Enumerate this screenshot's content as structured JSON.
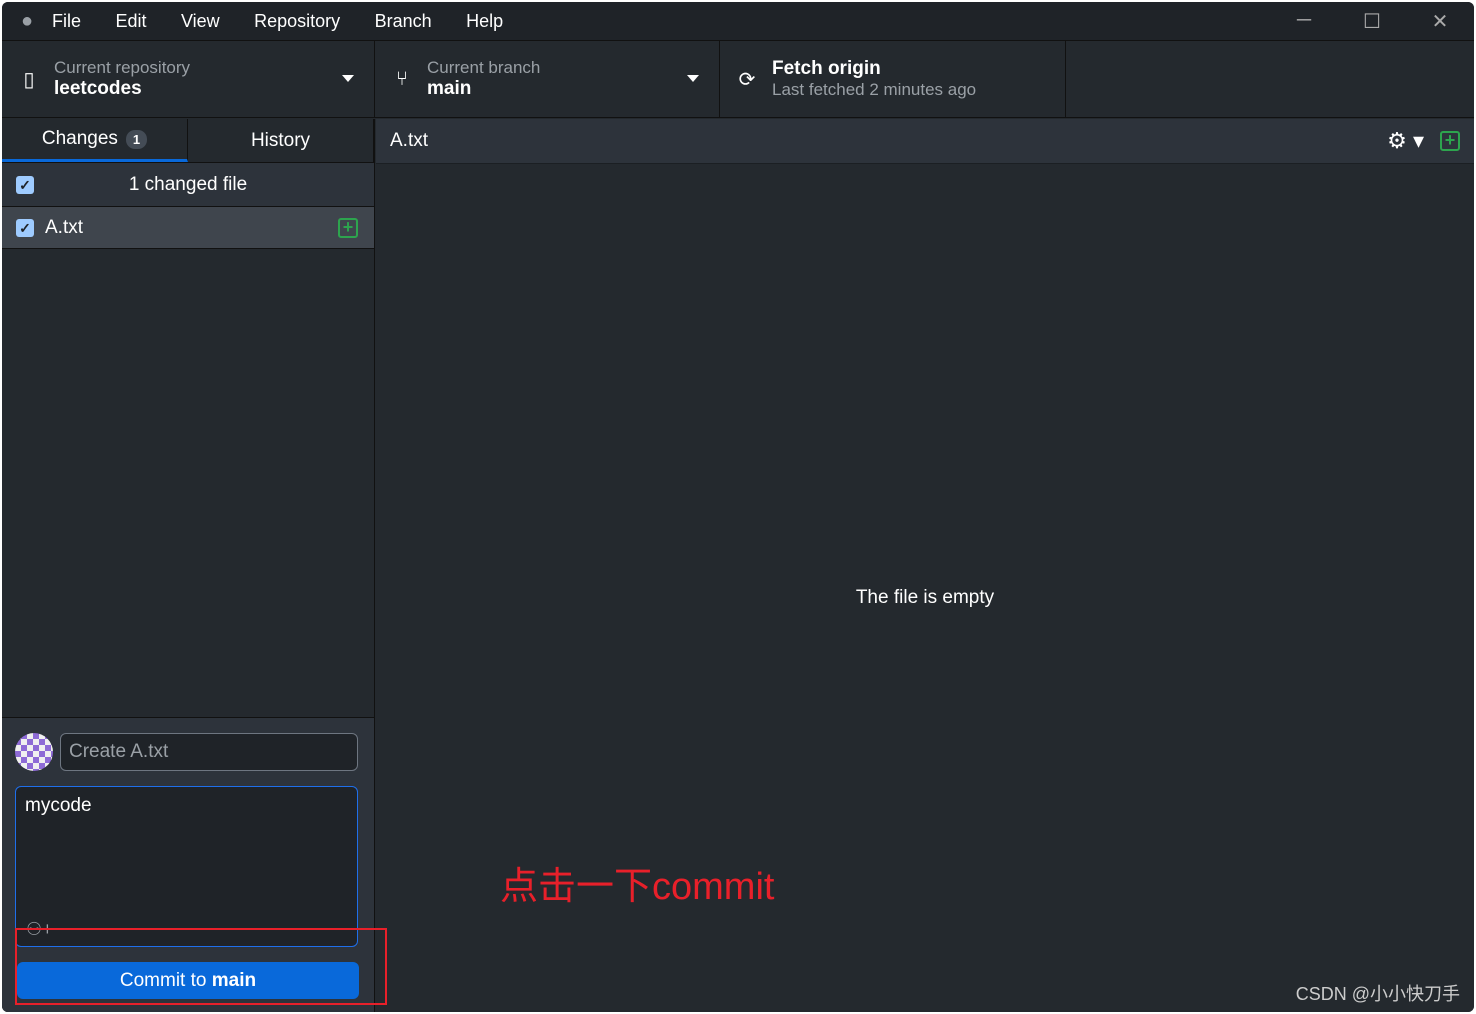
{
  "menu": [
    "File",
    "Edit",
    "View",
    "Repository",
    "Branch",
    "Help"
  ],
  "toolbar": {
    "repo_label": "Current repository",
    "repo": "leetcodes",
    "branch_label": "Current branch",
    "branch": "main",
    "fetch_title": "Fetch origin",
    "fetch_sub": "Last fetched 2 minutes ago"
  },
  "tabs": {
    "changes": "Changes",
    "changes_count": "1",
    "history": "History"
  },
  "changes": {
    "header": "1 changed file",
    "files": [
      "A.txt"
    ]
  },
  "commit": {
    "summary_placeholder": "Create A.txt",
    "description": "mycode",
    "button_prefix": "Commit to ",
    "button_branch": "main"
  },
  "diff": {
    "filename": "A.txt",
    "empty_message": "The file is empty"
  },
  "annotation": "点击一下commit",
  "watermark": "CSDN @小小快刀手",
  "colors": {
    "accent": "#0969da",
    "added": "#2da44e",
    "annotation": "#e8202a"
  }
}
